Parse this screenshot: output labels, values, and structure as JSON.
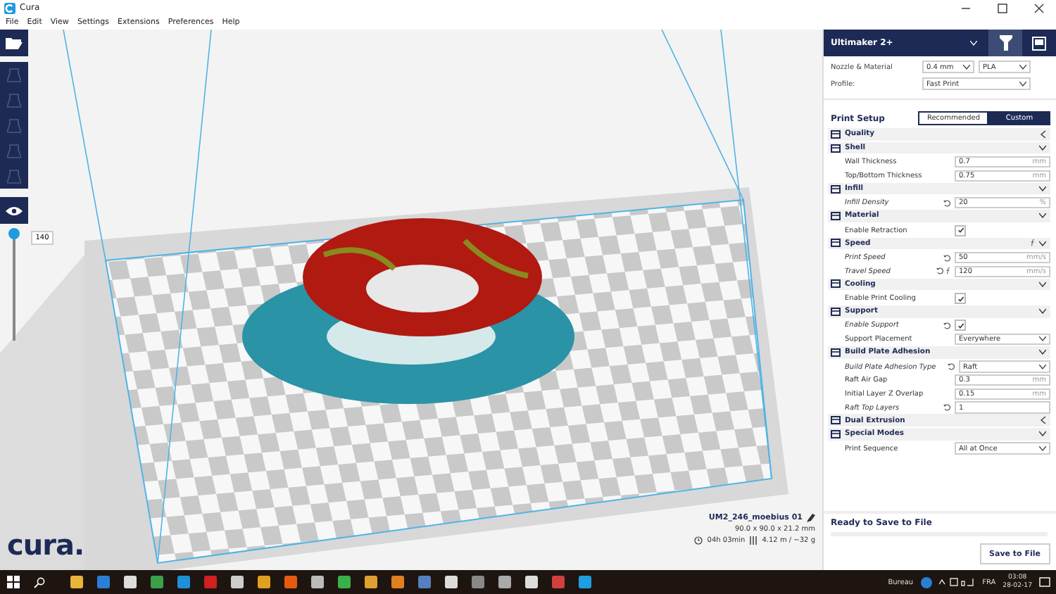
{
  "window": {
    "title": "Cura"
  },
  "menu": [
    "File",
    "Edit",
    "View",
    "Settings",
    "Extensions",
    "Preferences",
    "Help"
  ],
  "tools": [
    {
      "kind": "open"
    },
    {
      "kind": "translate",
      "disabled": true
    },
    {
      "kind": "scale",
      "disabled": true
    },
    {
      "kind": "rotate",
      "disabled": true
    },
    {
      "kind": "mirror",
      "disabled": true
    },
    {
      "kind": "per-model",
      "disabled": true
    },
    {
      "kind": "view"
    }
  ],
  "layer_slider": {
    "level": 1,
    "value": "140"
  },
  "logo": "cura.",
  "job": {
    "name": "UM2_246_moebius 01",
    "dimensions": "90.0 x 90.0 x 21.2 mm",
    "time": "04h 03min",
    "material": "4.12 m / ~32 g"
  },
  "panel": {
    "printer": "Ultimaker 2+",
    "tabs": [
      {
        "kind": "settings",
        "selected": true
      },
      {
        "kind": "monitor",
        "selected": false
      }
    ],
    "nozzle_label": "Nozzle & Material",
    "nozzle": "0.4 mm",
    "material": "PLA",
    "profile_label": "Profile:",
    "profile": "Fast Print",
    "setup_title": "Print Setup",
    "modes": [
      {
        "label": "Recommended",
        "selected": false
      },
      {
        "label": "Custom",
        "selected": true
      }
    ],
    "categories": [
      {
        "name": "Quality",
        "expanded": false
      },
      {
        "name": "Shell",
        "expanded": true,
        "settings": [
          {
            "label": "Wall Thickness",
            "kind": "number",
            "value": "0.7",
            "unit": "mm",
            "user_set": false
          },
          {
            "label": "Top/Bottom Thickness",
            "kind": "number",
            "value": "0.75",
            "unit": "mm",
            "user_set": false
          }
        ]
      },
      {
        "name": "Infill",
        "expanded": true,
        "settings": [
          {
            "label": "Infill Density",
            "kind": "number",
            "value": "20",
            "unit": "%",
            "user_set": true
          }
        ]
      },
      {
        "name": "Material",
        "expanded": true,
        "settings": [
          {
            "label": "Enable Retraction",
            "kind": "checkbox",
            "checked": true,
            "user_set": false
          }
        ]
      },
      {
        "name": "Speed",
        "expanded": true,
        "inherit": true,
        "settings": [
          {
            "label": "Print Speed",
            "kind": "number",
            "value": "50",
            "unit": "mm/s",
            "user_set": true
          },
          {
            "label": "Travel Speed",
            "kind": "number",
            "value": "120",
            "unit": "mm/s",
            "user_set": true,
            "inherit": true
          }
        ]
      },
      {
        "name": "Cooling",
        "expanded": true,
        "settings": [
          {
            "label": "Enable Print Cooling",
            "kind": "checkbox",
            "checked": true,
            "user_set": false
          }
        ]
      },
      {
        "name": "Support",
        "expanded": true,
        "settings": [
          {
            "label": "Enable Support",
            "kind": "checkbox",
            "checked": true,
            "user_set": true
          },
          {
            "label": "Support Placement",
            "kind": "dropdown",
            "value": "Everywhere",
            "user_set": false
          }
        ]
      },
      {
        "name": "Build Plate Adhesion",
        "expanded": true,
        "settings": [
          {
            "label": "Build Plate Adhesion Type",
            "kind": "dropdown",
            "value": "Raft",
            "user_set": true
          },
          {
            "label": "Raft Air Gap",
            "kind": "number",
            "value": "0.3",
            "unit": "mm",
            "user_set": false
          },
          {
            "label": "Initial Layer Z Overlap",
            "kind": "number",
            "value": "0.15",
            "unit": "mm",
            "user_set": false
          },
          {
            "label": "Raft Top Layers",
            "kind": "number",
            "value": "1",
            "user_set": true
          }
        ]
      },
      {
        "name": "Dual Extrusion",
        "expanded": false
      },
      {
        "name": "Special Modes",
        "expanded": true,
        "settings": [
          {
            "label": "Print Sequence",
            "kind": "dropdown",
            "value": "All at Once",
            "user_set": false
          }
        ]
      }
    ],
    "status": "Ready to Save to File",
    "progress": {
      "level": 0
    },
    "save_button": "Save to File"
  },
  "taskbar": {
    "desk_label": "Bureau",
    "lang": "FRA",
    "time": "03:08",
    "date": "28-02-17"
  }
}
